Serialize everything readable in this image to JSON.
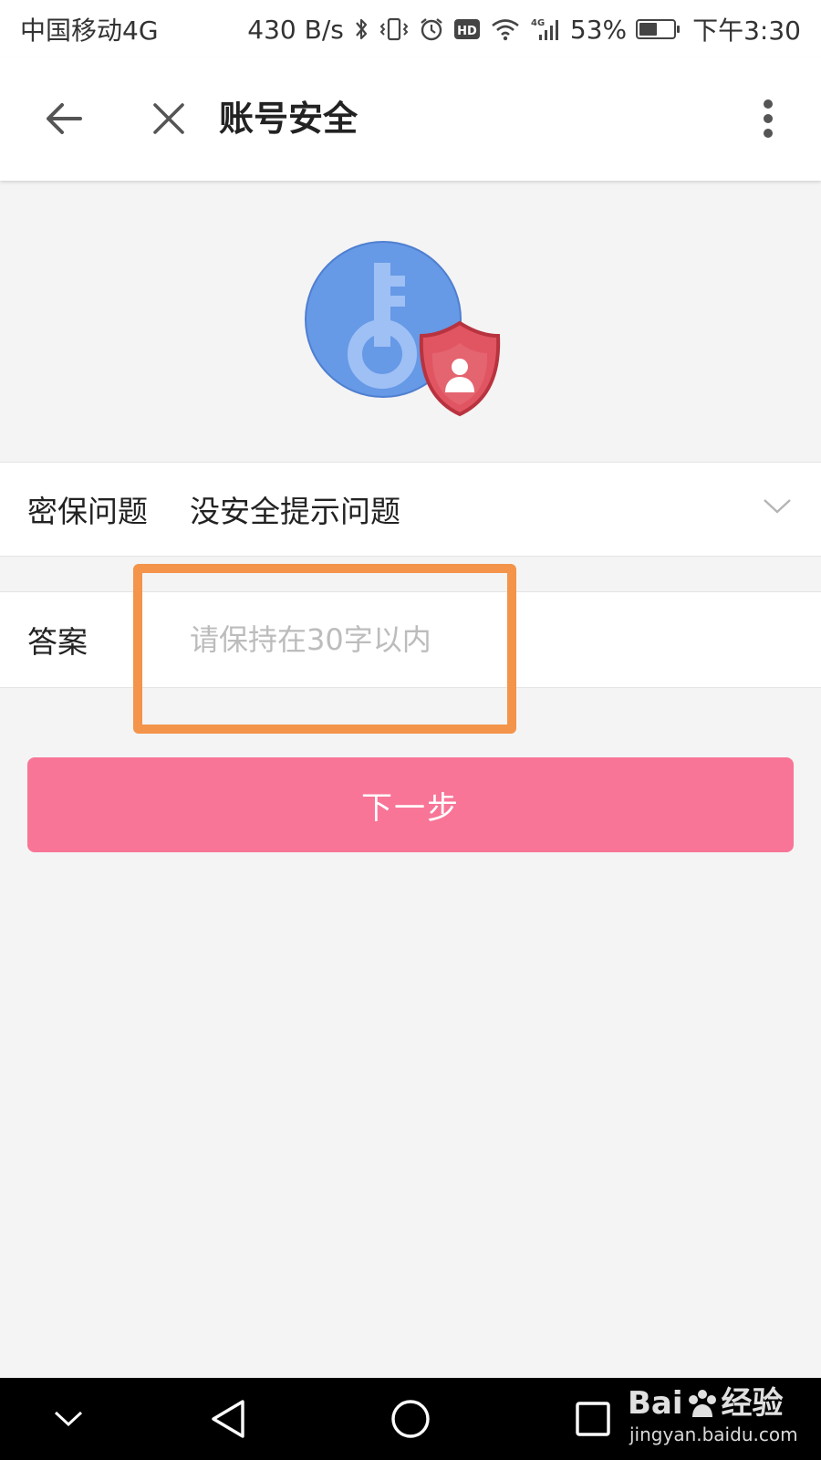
{
  "status_bar": {
    "carrier": "中国移动4G",
    "net_speed": "430 B/s",
    "network_type": "4G",
    "battery_percent": "53%",
    "battery_level": 0.53,
    "time": "下午3:30",
    "icons": [
      "bluetooth-icon",
      "vibrate-icon",
      "alarm-icon",
      "hd-icon",
      "wifi-icon",
      "signal-icon",
      "battery-icon"
    ]
  },
  "app_bar": {
    "title": "账号安全",
    "icons": [
      "back-arrow-icon",
      "close-icon",
      "more-vertical-icon"
    ]
  },
  "hero": {
    "icon": "key-shield-icon",
    "colors": {
      "circle": "#6699e6",
      "key": "#9ec0f5",
      "shield": "#e05561",
      "shield_border": "#b8333f"
    }
  },
  "form": {
    "question_label": "密保问题",
    "question_value": "没安全提示问题",
    "answer_label": "答案",
    "answer_value": "",
    "answer_placeholder": "请保持在30字以内",
    "next_label": "下一步"
  },
  "highlight": {
    "color": "#f3944a"
  },
  "theme": {
    "accent": "#f87597",
    "background": "#f4f4f4"
  },
  "nav_bar": {
    "icons": [
      "chevron-down-icon",
      "triangle-back-icon",
      "circle-home-icon",
      "square-recent-icon"
    ]
  },
  "watermark": {
    "logo_prefix": "Bai",
    "logo_suffix": "经验",
    "url": "jingyan.baidu.com"
  }
}
